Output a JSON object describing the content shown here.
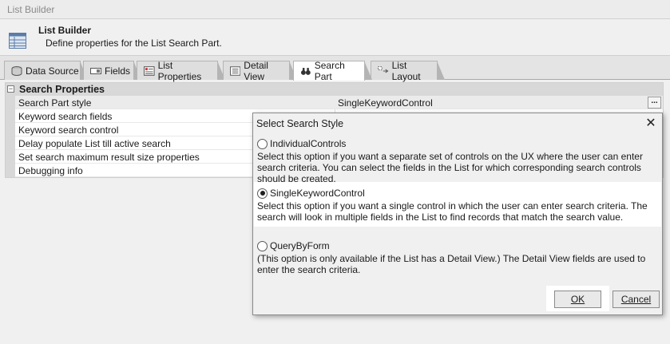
{
  "window": {
    "title": "List Builder"
  },
  "header": {
    "title": "List Builder",
    "subtitle": "Define properties for the List Search Part."
  },
  "tabs": [
    {
      "label": "Data Source",
      "icon": "database-icon"
    },
    {
      "label": "Fields",
      "icon": "fields-icon"
    },
    {
      "label": "List Properties",
      "icon": "list-properties-icon"
    },
    {
      "label": "Detail View",
      "icon": "detail-view-icon"
    },
    {
      "label": "Search Part",
      "icon": "binoculars-icon",
      "active": true
    },
    {
      "label": "List Layout",
      "icon": "list-layout-icon"
    }
  ],
  "grid": {
    "category": "Search Properties",
    "toggle": "−",
    "properties": [
      {
        "name": "Search Part style",
        "value": "SingleKeywordControl",
        "selected": true
      },
      {
        "name": "Keyword search fields",
        "value": ""
      },
      {
        "name": "Keyword search control",
        "value": ""
      },
      {
        "name": "Delay populate List till active search",
        "value": ""
      },
      {
        "name": "Set search maximum result size properties",
        "value": ""
      },
      {
        "name": "Debugging info",
        "value": ""
      }
    ],
    "ellipsis": "..."
  },
  "dialog": {
    "title": "Select Search Style",
    "close": "✕",
    "options": [
      {
        "label": "IndividualControls",
        "description": "Select this option if you want a separate set of controls on the UX where the user can enter search criteria. You can select the fields in the List for which corresponding search controls should be created.",
        "checked": false
      },
      {
        "label": "SingleKeywordControl",
        "description": "Select this option if you want a single control in which the user can enter search criteria. The search will look in multiple fields in the List to find records that match the search value.",
        "checked": true
      },
      {
        "label": "QueryByForm",
        "description": "(This option is only available if the List has a Detail View.) The Detail View fields are used to enter the search criteria.",
        "checked": false
      }
    ],
    "ok_label": "OK",
    "cancel_label": "Cancel"
  }
}
